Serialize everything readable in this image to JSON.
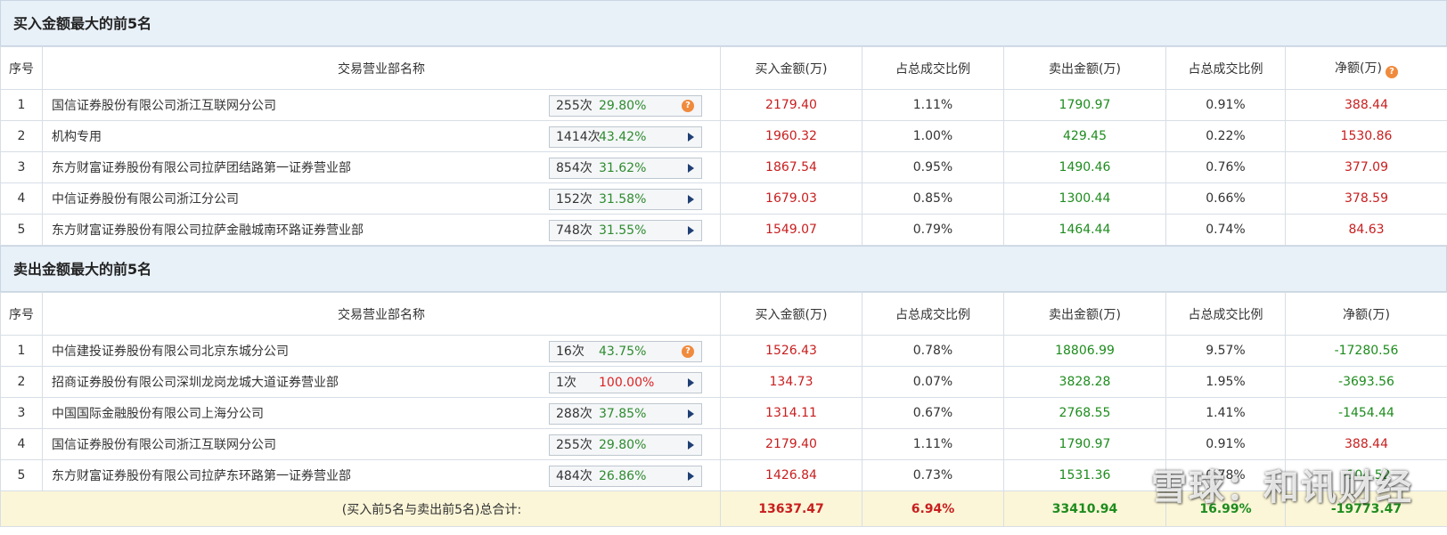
{
  "buy_section": {
    "title": "买入金额最大的前5名",
    "headers": [
      "序号",
      "交易营业部名称",
      "买入金额(万)",
      "占总成交比例",
      "卖出金额(万)",
      "占总成交比例",
      "净额(万)"
    ],
    "rows": [
      {
        "idx": "1",
        "name": "国信证券股份有限公司浙江互联网分公司",
        "count": "255次",
        "pct": "29.80%",
        "icon": "question-icon",
        "buy": "2179.40",
        "buy_ratio": "1.11%",
        "sell": "1790.97",
        "sell_ratio": "0.91%",
        "net": "388.44"
      },
      {
        "idx": "2",
        "name": "机构专用",
        "count": "1414次",
        "pct": "43.42%",
        "icon": "arrow-right-icon",
        "buy": "1960.32",
        "buy_ratio": "1.00%",
        "sell": "429.45",
        "sell_ratio": "0.22%",
        "net": "1530.86"
      },
      {
        "idx": "3",
        "name": "东方财富证券股份有限公司拉萨团结路第一证券营业部",
        "count": "854次",
        "pct": "31.62%",
        "icon": "arrow-right-icon",
        "buy": "1867.54",
        "buy_ratio": "0.95%",
        "sell": "1490.46",
        "sell_ratio": "0.76%",
        "net": "377.09"
      },
      {
        "idx": "4",
        "name": "中信证券股份有限公司浙江分公司",
        "count": "152次",
        "pct": "31.58%",
        "icon": "arrow-right-icon",
        "buy": "1679.03",
        "buy_ratio": "0.85%",
        "sell": "1300.44",
        "sell_ratio": "0.66%",
        "net": "378.59"
      },
      {
        "idx": "5",
        "name": "东方财富证券股份有限公司拉萨金融城南环路证券营业部",
        "count": "748次",
        "pct": "31.55%",
        "icon": "arrow-right-icon",
        "buy": "1549.07",
        "buy_ratio": "0.79%",
        "sell": "1464.44",
        "sell_ratio": "0.74%",
        "net": "84.63"
      }
    ]
  },
  "sell_section": {
    "title": "卖出金额最大的前5名",
    "headers": [
      "序号",
      "交易营业部名称",
      "买入金额(万)",
      "占总成交比例",
      "卖出金额(万)",
      "占总成交比例",
      "净额(万)"
    ],
    "rows": [
      {
        "idx": "1",
        "name": "中信建投证券股份有限公司北京东城分公司",
        "count": "16次",
        "pct": "43.75%",
        "icon": "question-icon",
        "buy": "1526.43",
        "buy_ratio": "0.78%",
        "sell": "18806.99",
        "sell_ratio": "9.57%",
        "net": "-17280.56"
      },
      {
        "idx": "2",
        "name": "招商证券股份有限公司深圳龙岗龙城大道证券营业部",
        "count": "1次",
        "pct": "100.00%",
        "icon": "arrow-right-icon",
        "buy": "134.73",
        "buy_ratio": "0.07%",
        "sell": "3828.28",
        "sell_ratio": "1.95%",
        "net": "-3693.56"
      },
      {
        "idx": "3",
        "name": "中国国际金融股份有限公司上海分公司",
        "count": "288次",
        "pct": "37.85%",
        "icon": "arrow-right-icon",
        "buy": "1314.11",
        "buy_ratio": "0.67%",
        "sell": "2768.55",
        "sell_ratio": "1.41%",
        "net": "-1454.44"
      },
      {
        "idx": "4",
        "name": "国信证券股份有限公司浙江互联网分公司",
        "count": "255次",
        "pct": "29.80%",
        "icon": "arrow-right-icon",
        "buy": "2179.40",
        "buy_ratio": "1.11%",
        "sell": "1790.97",
        "sell_ratio": "0.91%",
        "net": "388.44"
      },
      {
        "idx": "5",
        "name": "东方财富证券股份有限公司拉萨东环路第一证券营业部",
        "count": "484次",
        "pct": "26.86%",
        "icon": "arrow-right-icon",
        "buy": "1426.84",
        "buy_ratio": "0.73%",
        "sell": "1531.36",
        "sell_ratio": "0.78%",
        "net": "-104.52"
      }
    ]
  },
  "total": {
    "label": "(买入前5名与卖出前5名)总合计:",
    "buy": "13637.47",
    "buy_ratio": "6.94%",
    "sell": "33410.94",
    "sell_ratio": "16.99%",
    "net": "-19773.47"
  },
  "watermark": "雪球：和讯财经",
  "colors": {
    "header_bg": "#e8f0f8",
    "total_bg": "#fbf6d8",
    "red": "#c81e1e",
    "green": "#1e8c1e",
    "pill_pct_green": "#2e8b2e",
    "pill_pct_red": "#dd2222"
  }
}
